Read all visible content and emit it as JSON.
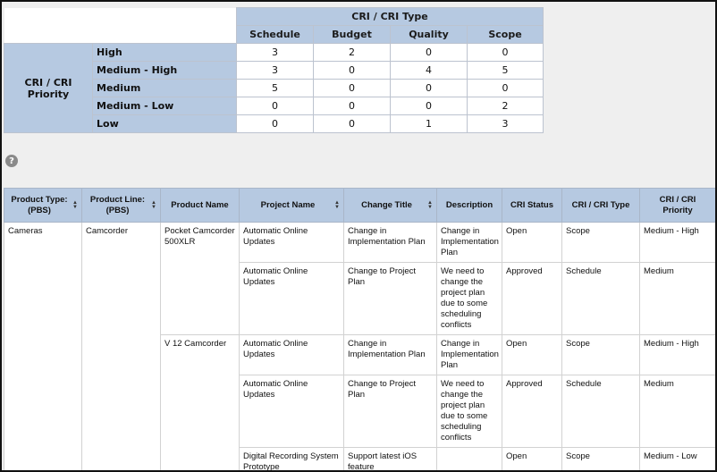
{
  "pivot": {
    "col_group_label": "CRI / CRI Type",
    "row_group_label": "CRI / CRI Priority",
    "columns": [
      "Schedule",
      "Budget",
      "Quality",
      "Scope"
    ],
    "rows": [
      {
        "label": "High",
        "values": [
          "3",
          "2",
          "0",
          "0"
        ]
      },
      {
        "label": "Medium - High",
        "values": [
          "3",
          "0",
          "4",
          "5"
        ]
      },
      {
        "label": "Medium",
        "values": [
          "5",
          "0",
          "0",
          "0"
        ]
      },
      {
        "label": "Medium - Low",
        "values": [
          "0",
          "0",
          "0",
          "2"
        ]
      },
      {
        "label": "Low",
        "values": [
          "0",
          "0",
          "1",
          "3"
        ]
      }
    ]
  },
  "help": {
    "glyph": "?"
  },
  "icons": {
    "sort_up": "▲",
    "sort_down": "▼"
  },
  "grid": {
    "headers": [
      "Product Type: (PBS)",
      "Product Line: (PBS)",
      "Product Name",
      "Project Name",
      "Change Title",
      "Description",
      "CRI Status",
      "CRI / CRI Type",
      "CRI / CRI Priority"
    ],
    "product_type": "Cameras",
    "product_line": "Camcorder",
    "products": [
      "Pocket Camcorder 500XLR",
      "V 12 Camcorder"
    ],
    "rows": [
      {
        "project": "Automatic Online Updates",
        "title": "Change in Implementation Plan",
        "desc": "Change in Implementation Plan",
        "status": "Open",
        "type": "Scope",
        "priority": "Medium - High"
      },
      {
        "project": "Automatic Online Updates",
        "title": "Change to Project Plan",
        "desc": "We need to change the project plan due to some scheduling conflicts",
        "status": "Approved",
        "type": "Schedule",
        "priority": "Medium"
      },
      {
        "project": "Automatic Online Updates",
        "title": "Change in Implementation Plan",
        "desc": "Change in Implementation Plan",
        "status": "Open",
        "type": "Scope",
        "priority": "Medium - High"
      },
      {
        "project": "Automatic Online Updates",
        "title": "Change to Project Plan",
        "desc": "We need to change the project plan due to some scheduling conflicts",
        "status": "Approved",
        "type": "Schedule",
        "priority": "Medium"
      },
      {
        "project": "Digital Recording System Prototype",
        "title": "Support latest iOS feature",
        "desc": "",
        "status": "Open",
        "type": "Scope",
        "priority": "Medium - Low"
      }
    ]
  }
}
